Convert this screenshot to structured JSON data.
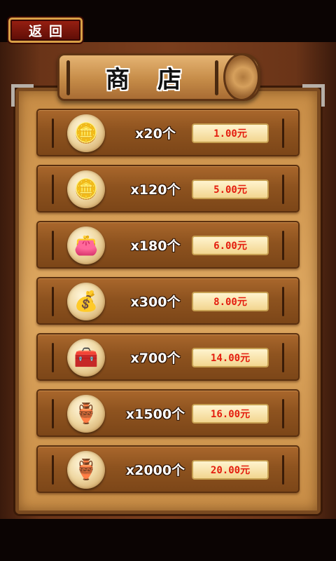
{
  "header": {
    "back_label": "返回"
  },
  "shop": {
    "title": "商店",
    "items": [
      {
        "quantity": "x20个",
        "price": "1.00元",
        "icon": "coin-stack-icon"
      },
      {
        "quantity": "x120个",
        "price": "5.00元",
        "icon": "coin-stacks-icon"
      },
      {
        "quantity": "x180个",
        "price": "6.00元",
        "icon": "coin-bag-icon"
      },
      {
        "quantity": "x300个",
        "price": "8.00元",
        "icon": "coin-sack-icon"
      },
      {
        "quantity": "x700个",
        "price": "14.00元",
        "icon": "treasure-chest-icon"
      },
      {
        "quantity": "x1500个",
        "price": "16.00元",
        "icon": "gold-pot-icon"
      },
      {
        "quantity": "x2000个",
        "price": "20.00元",
        "icon": "gold-cauldron-icon"
      }
    ]
  },
  "colors": {
    "price_text": "#e41d0e",
    "panel_wood": "#dda760",
    "row_wood": "#8e531f"
  }
}
